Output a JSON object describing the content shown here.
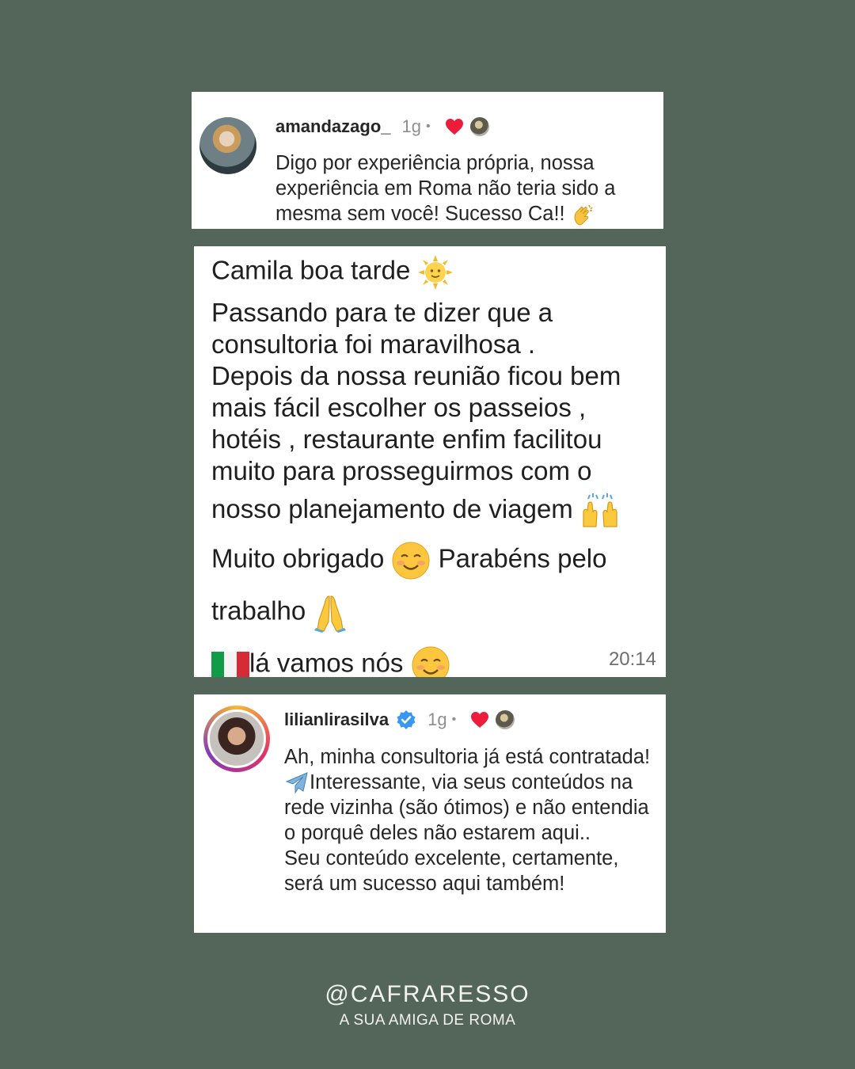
{
  "comment1": {
    "username": "amandazago_",
    "time": "1g",
    "separator": "•",
    "text": "Digo por experiência própria, nossa experiência em Roma não teria sido a mesma sem você!  Sucesso Ca!! "
  },
  "message": {
    "line1": "Camila boa tarde ",
    "line2": "Passando para te dizer que a",
    "line3": "consultoria foi maravilhosa .",
    "line4": "Depois da nossa reunião ficou bem",
    "line5": "mais fácil escolher os passeios ,",
    "line6": "hotéis , restaurante enfim facilitou",
    "line7": "muito para prosseguirmos com o",
    "line8": "nosso planejamento de viagem ",
    "line9a": "Muito obrigado ",
    "line9b": " Parabéns pelo",
    "line10": "trabalho ",
    "line11": "lá vamos nós ",
    "timestamp": "20:14"
  },
  "comment2": {
    "username": "lilianlirasilva",
    "time": "1g",
    "separator": "•",
    "text1": "Ah, minha consultoria já está contratada! ",
    "text2": "Interessante, via seus conteúdos na rede vizinha (são ótimos) e não entendia o porquê deles não estarem aqui..",
    "text3": "Seu conteúdo excelente, certamente, será um sucesso aqui também!"
  },
  "footer": {
    "handle": "@CAFRARESSO",
    "tagline": "A SUA AMIGA DE ROMA"
  },
  "colors": {
    "background": "#546659",
    "heart": "#ed1c3a",
    "verified": "#3897f0"
  },
  "icons": [
    "heart-icon",
    "verified-badge-icon",
    "clapping-hands-icon",
    "sun-face-icon",
    "raising-hands-icon",
    "smiling-face-icon",
    "folded-hands-icon",
    "italy-flag-icon",
    "airplane-icon"
  ]
}
